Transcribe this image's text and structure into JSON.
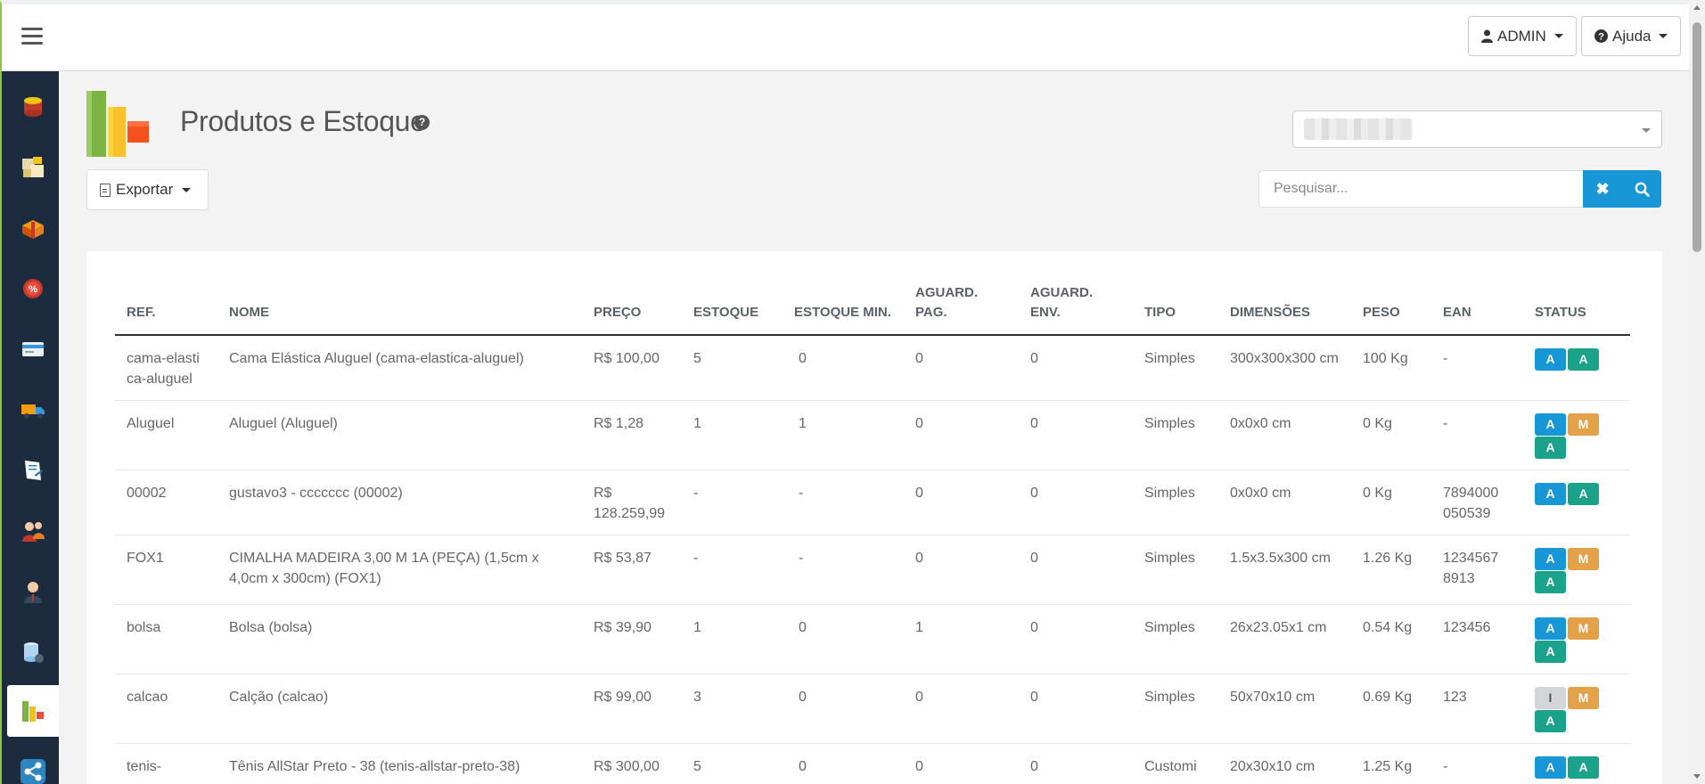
{
  "header": {
    "user_label": "ADMIN",
    "help_label": "Ajuda"
  },
  "sidebar": {
    "items": [
      {
        "name": "database-icon"
      },
      {
        "name": "boxes-icon"
      },
      {
        "name": "package-icon"
      },
      {
        "name": "discount-icon"
      },
      {
        "name": "credit-card-icon"
      },
      {
        "name": "truck-icon"
      },
      {
        "name": "notepad-icon"
      },
      {
        "name": "users-icon"
      },
      {
        "name": "user-icon"
      },
      {
        "name": "server-icon"
      },
      {
        "name": "chart-icon"
      },
      {
        "name": "share-icon"
      }
    ],
    "active_index": 10
  },
  "page": {
    "title": "Produtos e Estoque",
    "help_icon": "?"
  },
  "toolbar": {
    "export_label": "Exportar",
    "search_placeholder": "Pesquisar...",
    "clear_icon": "✖",
    "search_icon": "search-icon"
  },
  "table": {
    "columns": [
      "REF.",
      "NOME",
      "PREÇO",
      "ESTOQUE",
      "ESTOQUE MIN.",
      "AGUARD. PAG.",
      "AGUARD. ENV.",
      "TIPO",
      "DIMENSÕES",
      "PESO",
      "EAN",
      "STATUS"
    ],
    "rows": [
      {
        "ref": "cama-elastica-aluguel",
        "nome": "Cama Elástica Aluguel (cama-elastica-aluguel)",
        "preco": "R$ 100,00",
        "estoque": "5",
        "estoque_min": "0",
        "aguard_pag": "0",
        "aguard_env": "0",
        "tipo": "Simples",
        "dimensoes": "300x300x300 cm",
        "peso": "100 Kg",
        "ean": "-",
        "status": [
          {
            "label": "A",
            "color": "#1797d5"
          },
          {
            "label": "A",
            "color": "#1aa38a"
          }
        ]
      },
      {
        "ref": "Aluguel",
        "nome": "Aluguel (Aluguel)",
        "preco": "R$ 1,28",
        "estoque": "1",
        "estoque_min": "1",
        "aguard_pag": "0",
        "aguard_env": "0",
        "tipo": "Simples",
        "dimensoes": "0x0x0 cm",
        "peso": "0 Kg",
        "ean": "-",
        "status": [
          {
            "label": "A",
            "color": "#1797d5"
          },
          {
            "label": "M",
            "color": "#e3a148"
          },
          {
            "label": "A",
            "color": "#1aa38a"
          }
        ]
      },
      {
        "ref": "00002",
        "nome": "gustavo3 - ccccccc (00002)",
        "preco": "R$ 128.259,99",
        "estoque": "-",
        "estoque_min": "-",
        "aguard_pag": "0",
        "aguard_env": "0",
        "tipo": "Simples",
        "dimensoes": "0x0x0 cm",
        "peso": "0 Kg",
        "ean": "7894000 050539",
        "status": [
          {
            "label": "A",
            "color": "#1797d5"
          },
          {
            "label": "A",
            "color": "#1aa38a"
          }
        ]
      },
      {
        "ref": "FOX1",
        "nome": "CIMALHA MADEIRA 3,00 M 1A (PEÇA) (1,5cm x 4,0cm x 300cm) (FOX1)",
        "preco": "R$ 53,87",
        "estoque": "-",
        "estoque_min": "-",
        "aguard_pag": "0",
        "aguard_env": "0",
        "tipo": "Simples",
        "dimensoes": "1.5x3.5x300 cm",
        "peso": "1.26 Kg",
        "ean": "1234567 8913",
        "status": [
          {
            "label": "A",
            "color": "#1797d5"
          },
          {
            "label": "M",
            "color": "#e3a148"
          },
          {
            "label": "A",
            "color": "#1aa38a"
          }
        ]
      },
      {
        "ref": "bolsa",
        "nome": "Bolsa (bolsa)",
        "preco": "R$ 39,90",
        "estoque": "1",
        "estoque_min": "0",
        "aguard_pag": "1",
        "aguard_env": "0",
        "tipo": "Simples",
        "dimensoes": "26x23.05x1 cm",
        "peso": "0.54 Kg",
        "ean": "123456",
        "status": [
          {
            "label": "A",
            "color": "#1797d5"
          },
          {
            "label": "M",
            "color": "#e3a148"
          },
          {
            "label": "A",
            "color": "#1aa38a"
          }
        ]
      },
      {
        "ref": "calcao",
        "nome": "Calção (calcao)",
        "preco": "R$ 99,00",
        "estoque": "3",
        "estoque_min": "0",
        "aguard_pag": "0",
        "aguard_env": "0",
        "tipo": "Simples",
        "dimensoes": "50x70x10 cm",
        "peso": "0.69 Kg",
        "ean": "123",
        "status": [
          {
            "label": "I",
            "color": "#d3d6d8"
          },
          {
            "label": "M",
            "color": "#e3a148"
          },
          {
            "label": "A",
            "color": "#1aa38a"
          }
        ]
      },
      {
        "ref": "tenis-",
        "nome": "Tênis AllStar Preto - 38 (tenis-allstar-preto-38)",
        "preco": "R$ 300,00",
        "estoque": "5",
        "estoque_min": "0",
        "aguard_pag": "0",
        "aguard_env": "0",
        "tipo": "Customi",
        "dimensoes": "20x30x10 cm",
        "peso": "1.25 Kg",
        "ean": "-",
        "status": [
          {
            "label": "A",
            "color": "#1797d5"
          },
          {
            "label": "A",
            "color": "#1aa38a"
          }
        ]
      }
    ]
  }
}
